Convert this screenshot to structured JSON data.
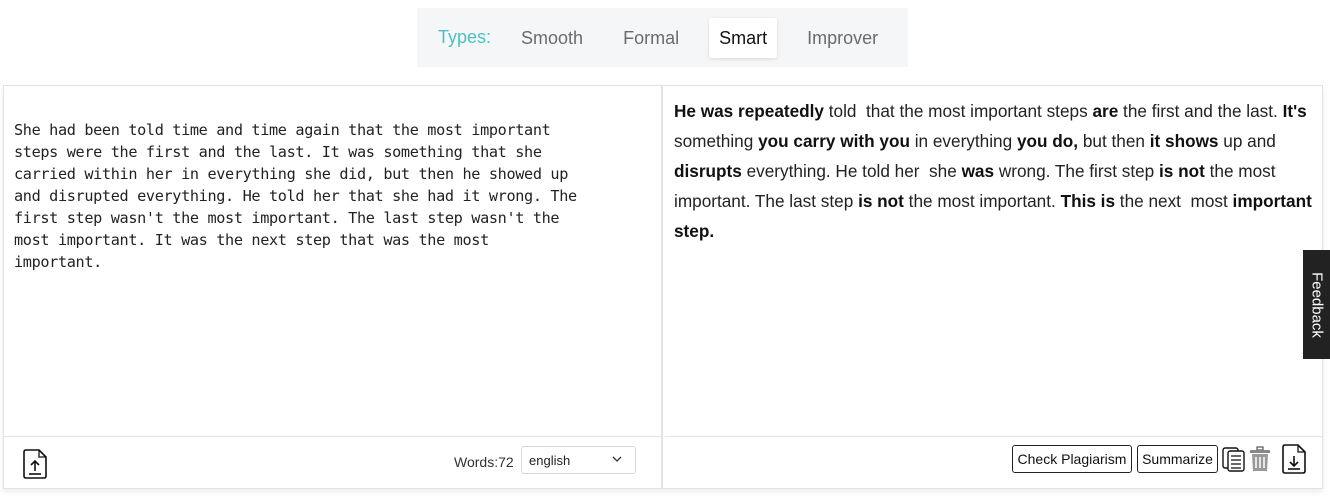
{
  "types_bar": {
    "label": "Types:",
    "tabs": [
      {
        "label": "Smooth",
        "active": false
      },
      {
        "label": "Formal",
        "active": false
      },
      {
        "label": "Smart",
        "active": true
      },
      {
        "label": "Improver",
        "active": false
      }
    ]
  },
  "input": {
    "text": "She had been told time and time again that the most important\nsteps were the first and the last. It was something that she\ncarried within her in everything she did, but then he showed up\nand disrupted everything. He told her that she had it wrong. The\nfirst step wasn't the most important. The last step wasn't the\nmost important. It was the next step that was the most\nimportant."
  },
  "output": {
    "segments": [
      {
        "text": "He was repeatedly",
        "bold": true
      },
      {
        "text": " told  that the most important steps ",
        "bold": false
      },
      {
        "text": "are",
        "bold": true
      },
      {
        "text": " the first and the last. ",
        "bold": false
      },
      {
        "text": "It's",
        "bold": true
      },
      {
        "text": " something ",
        "bold": false
      },
      {
        "text": "you carry with you",
        "bold": true
      },
      {
        "text": " in everything ",
        "bold": false
      },
      {
        "text": "you do,",
        "bold": true
      },
      {
        "text": " but then ",
        "bold": false
      },
      {
        "text": "it shows",
        "bold": true
      },
      {
        "text": " up and ",
        "bold": false
      },
      {
        "text": "disrupts",
        "bold": true
      },
      {
        "text": " everything. He told her  she ",
        "bold": false
      },
      {
        "text": "was",
        "bold": true
      },
      {
        "text": " wrong. The first step ",
        "bold": false
      },
      {
        "text": "is not",
        "bold": true
      },
      {
        "text": " the most important. The last step ",
        "bold": false
      },
      {
        "text": "is not",
        "bold": true
      },
      {
        "text": " the most important. ",
        "bold": false
      },
      {
        "text": "This is",
        "bold": true
      },
      {
        "text": " the next  most ",
        "bold": false
      },
      {
        "text": "important step.",
        "bold": true
      }
    ]
  },
  "footer_left": {
    "upload_icon": "file-upload-icon",
    "words_label": "Words:72",
    "language": "english"
  },
  "footer_right": {
    "check_plagiarism": "Check Plagiarism",
    "summarize": "Summarize",
    "copy_icon": "copy-icon",
    "delete_icon": "trash-icon",
    "download_icon": "file-download-icon"
  },
  "feedback": {
    "label": "Feedback"
  },
  "colors": {
    "accent": "#4fbfc4",
    "feedback_bg": "#222222",
    "types_bg": "#f4f6f8"
  }
}
